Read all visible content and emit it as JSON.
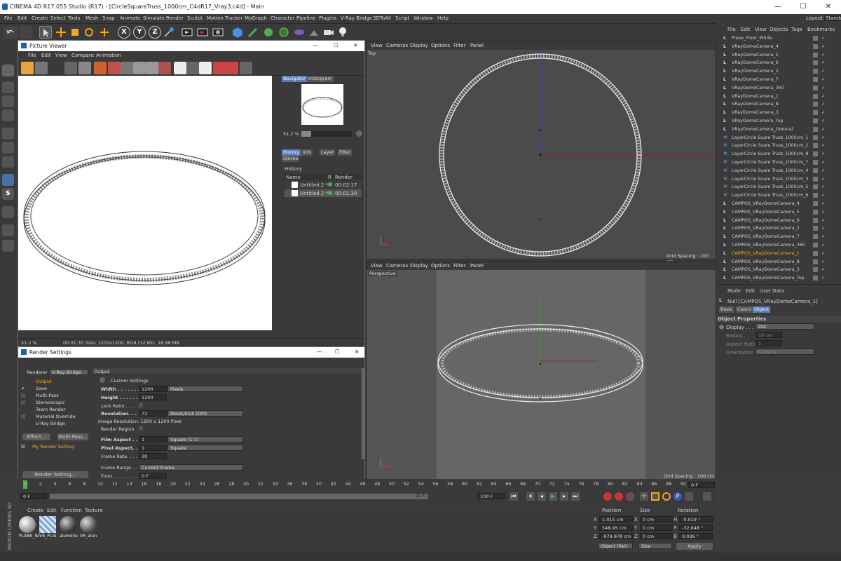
{
  "window": {
    "title": "CINEMA 4D R17.055 Studio (R17) - [CircleSquareTruss_1000cm_C4dR17_Vray3.c4d] - Main",
    "minimize": "—",
    "maximize": "☐",
    "close": "✕"
  },
  "menubar": [
    "File",
    "Edit",
    "Create",
    "Select",
    "Tools",
    "Mesh",
    "Snap",
    "Animate",
    "Simulate",
    "Render",
    "Sculpt",
    "Motion Tracker",
    "MoGraph",
    "Character",
    "Pipeline",
    "Plugins",
    "V-Ray Bridge",
    "3DToAll",
    "Script",
    "Window",
    "Help"
  ],
  "layout": {
    "label": "Layout:",
    "value": "Standa"
  },
  "toolbar_axes": [
    "X",
    "Y",
    "Z"
  ],
  "viewport_menu": [
    "View",
    "Cameras",
    "Display",
    "Options",
    "Filter",
    "Panel"
  ],
  "top_view": {
    "label": "Top",
    "grid": "Grid Spacing : 100 cm"
  },
  "persp_view": {
    "label": "Perspective",
    "grid": "Grid Spacing : 100 cm"
  },
  "picture_viewer": {
    "title": "Picture Viewer",
    "menu": [
      "File",
      "Edit",
      "View",
      "Compare",
      "Animation"
    ],
    "tabs1": [
      "Navigator",
      "Histogram"
    ],
    "zoom": "51.2 %",
    "tabs2": [
      "History",
      "Info",
      "Layer",
      "Filter",
      "Stereo"
    ],
    "history_label": "History",
    "cols": [
      "Name",
      "R",
      "Render Time"
    ],
    "rows": [
      {
        "name": "Untitled 2 *",
        "time": "00:02:17"
      },
      {
        "name": "Untitled 2 *",
        "time": "00:01:30"
      }
    ],
    "status_zoom": "51.2 %",
    "status_time": "00:01:30",
    "status_info": "Size: 1200x1200, RGB (32 Bit), 16.96 MB"
  },
  "render_settings": {
    "title": "Render Settings",
    "renderer_label": "Renderer",
    "renderer_value": "V-Ray Bridge",
    "list": [
      "Output",
      "Save",
      "Multi-Pass",
      "Stereoscopic",
      "Team Render",
      "Material Override",
      "V-Ray Bridge"
    ],
    "effect_btn": "Effect...",
    "multipass_btn": "Multi-Pass...",
    "preset": "My Render Setting",
    "render_setting_btn": "Render Setting...",
    "section": "Output",
    "custom": "Custom Settings",
    "width_label": "Width . . . . . . . . .",
    "width": "1200",
    "units": "Pixels",
    "height_label": "Height . . . . . . . .",
    "height": "1200",
    "lock_label": "Lock Ratio . . . . .",
    "res_label": "Resolution. . . . . .",
    "res": "72",
    "res_units": "Pixels/Inch (DPI)",
    "image_res": "Image Resolution: 1200 x 1200 Pixel",
    "region_label": "Render Region",
    "film_label": "Film Aspect . . . . .",
    "film": "1",
    "film_dd": "Square (1:1)",
    "pixel_label": "Pixel Aspect. . . .",
    "pixel": "1",
    "pixel_dd": "Square",
    "frame_rate_label": "Frame Rate. . . . .",
    "frame_rate": "30",
    "frame_range_label": "Frame Range . . .",
    "frame_range": "Current Frame",
    "from_label": "From. . . . . . . . . .",
    "from": "0 F"
  },
  "objects": {
    "menu": [
      "File",
      "Edit",
      "View",
      "Objects",
      "Tags",
      "Bookmarks"
    ],
    "items": [
      "Plane_Floor_White",
      "VRayDomeCamera_4",
      "VRayDomeCamera_5",
      "VRayDomeCamera_6",
      "VRayDomeCamera_2",
      "VRayDomeCamera_7",
      "VRayDomeCamera_360",
      "VRayDomeCamera_1",
      "VRayDomeCamera_8",
      "VRayDomeCamera_3",
      "VRayDomeCamera_Top",
      "VRayDomeCamera_General",
      "LayerCircle Suare Truss_1000cm_1",
      "LayerCircle Suare Truss_1000cm_2",
      "LayerCircle Suare Truss_1000cm_8",
      "LayerCircle Suare Truss_1000cm_7",
      "LayerCircle Suare Truss_1000cm_4",
      "LayerCircle Suare Truss_1000cm_3",
      "LayerCircle Suare Truss_1000cm_5",
      "LayerCircle Suare Truss_1000cm_6",
      "CAMPOS_VRayDomeCamera_4",
      "CAMPOS_VRayDomeCamera_5",
      "CAMPOS_VRayDomeCamera_6",
      "CAMPOS_VRayDomeCamera_2",
      "CAMPOS_VRayDomeCamera_7",
      "CAMPOS_VRayDomeCamera_360",
      "CAMPOS_VRayDomeCamera_1",
      "CAMPOS_VRayDomeCamera_8",
      "CAMPOS_VRayDomeCamera_3",
      "CAMPOS_VRayDomeCamera_Top"
    ],
    "selected_index": 26
  },
  "attributes": {
    "menu": [
      "Mode",
      "Edit",
      "User Data"
    ],
    "object": "Null [CAMPOS_VRayDomeCamera_1]",
    "tabs": [
      "Basic",
      "Coord.",
      "Object"
    ],
    "section": "Object Properties",
    "display_label": "Display . . . .",
    "display": "Dot",
    "radius_label": "Radius . . . .",
    "radius": "10 cm",
    "aspect_label": "Aspect Ratio",
    "aspect": "1",
    "orient_label": "Orientation",
    "orient": "Camera"
  },
  "timeline": {
    "ticks": [
      "0",
      "2",
      "4",
      "6",
      "8",
      "10",
      "12",
      "14",
      "16",
      "18",
      "20",
      "22",
      "24",
      "26",
      "28",
      "30",
      "32",
      "34",
      "36",
      "38",
      "40",
      "42",
      "44",
      "46",
      "48",
      "50",
      "52",
      "54",
      "56",
      "58",
      "60",
      "62",
      "64",
      "66",
      "68",
      "70",
      "72",
      "74",
      "76",
      "78",
      "80",
      "82",
      "84",
      "86",
      "88",
      "90"
    ],
    "frame_end_field": "0 F",
    "start": "0 F",
    "end_label": "90 F",
    "end": "100 F"
  },
  "materials": {
    "menu": [
      "Create",
      "Edit",
      "Function",
      "Texture"
    ],
    "items": [
      "PLANE_W",
      "VR_PLAI",
      "aluminiu",
      "VR_alun"
    ]
  },
  "coords": {
    "headers": [
      "Position",
      "Size",
      "Rotation"
    ],
    "rows": [
      {
        "axis": "X",
        "pos": "1.015 cm",
        "size_axis": "X",
        "size": "0 cm",
        "rot_axis": "H",
        "rot": "-0.019 °"
      },
      {
        "axis": "Y",
        "pos": "548.95 cm",
        "size_axis": "Y",
        "size": "0 cm",
        "rot_axis": "P",
        "rot": "-32.848 °"
      },
      {
        "axis": "Z",
        "pos": "-979.978 cm",
        "size_axis": "Z",
        "size": "0 cm",
        "rot_axis": "B",
        "rot": "0.036 °"
      }
    ],
    "mode": "Object (Rel)",
    "size_mode": "Size",
    "apply": "Apply"
  },
  "brand": "MAXON CINEMA 4D"
}
